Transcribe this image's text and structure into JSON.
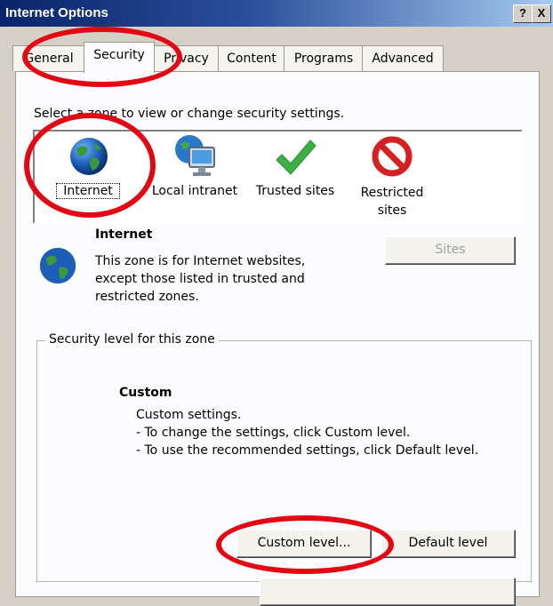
{
  "window": {
    "title": "Internet Options",
    "help_label": "?",
    "close_label": "X"
  },
  "tabs": [
    {
      "label": "General"
    },
    {
      "label": "Security"
    },
    {
      "label": "Privacy"
    },
    {
      "label": "Content"
    },
    {
      "label": "Programs"
    },
    {
      "label": "Advanced"
    }
  ],
  "security": {
    "zone_prompt": "Select a zone to view or change security settings.",
    "zones": [
      {
        "label": "Internet",
        "icon": "globe-icon"
      },
      {
        "label": "Local intranet",
        "icon": "intranet-computer-icon"
      },
      {
        "label": "Trusted sites",
        "icon": "green-check-icon"
      },
      {
        "label": "Restricted sites",
        "icon": "no-entry-icon"
      }
    ],
    "selected_zone": {
      "title": "Internet",
      "description": "This zone is for Internet websites, except those listed in trusted and restricted zones."
    },
    "sites_button": "Sites",
    "level_group_title": "Security level for this zone",
    "level": {
      "name": "Custom",
      "line1": "Custom settings.",
      "line2": "- To change the settings, click Custom level.",
      "line3": "- To use the recommended settings, click Default level."
    },
    "custom_level_button": "Custom level...",
    "default_level_button": "Default level"
  },
  "annotation_color": "#e30613"
}
